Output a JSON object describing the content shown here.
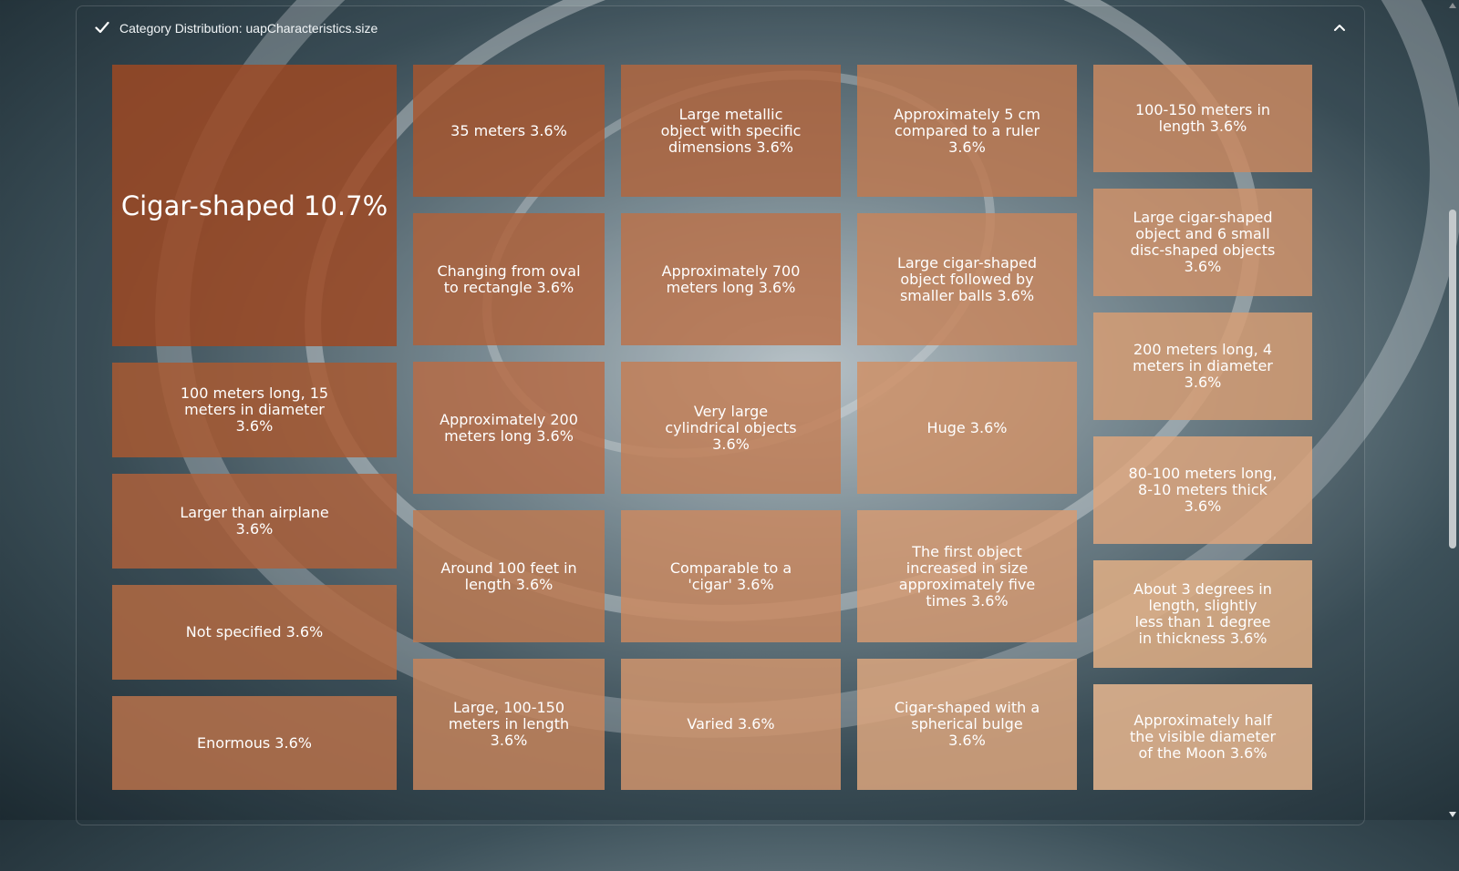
{
  "header": {
    "title": "Category Distribution: uapCharacteristics.size"
  },
  "icons": {
    "check": "check-icon",
    "collapse": "chevron-up-icon"
  },
  "colors": {
    "tile_dark": "#8f330d",
    "tile_light": "#f4c79d"
  },
  "chart_data": {
    "type": "treemap",
    "items": [
      {
        "label": "Cigar-shaped",
        "percent": 10.7
      },
      {
        "label": "100 meters long, 15 meters in diameter",
        "percent": 3.6
      },
      {
        "label": "Larger than airplane",
        "percent": 3.6
      },
      {
        "label": "Not specified",
        "percent": 3.6
      },
      {
        "label": "Enormous",
        "percent": 3.6
      },
      {
        "label": "35 meters",
        "percent": 3.6
      },
      {
        "label": "Changing from oval to rectangle",
        "percent": 3.6
      },
      {
        "label": "Approximately 200 meters long",
        "percent": 3.6
      },
      {
        "label": "Around 100 feet in length",
        "percent": 3.6
      },
      {
        "label": "Large, 100-150 meters in length",
        "percent": 3.6
      },
      {
        "label": "Large metallic object with specific dimensions",
        "percent": 3.6
      },
      {
        "label": "Approximately 700 meters long",
        "percent": 3.6
      },
      {
        "label": "Very large cylindrical objects",
        "percent": 3.6
      },
      {
        "label": "Comparable to a 'cigar'",
        "percent": 3.6
      },
      {
        "label": "Varied",
        "percent": 3.6
      },
      {
        "label": "Approximately 5 cm compared to a ruler",
        "percent": 3.6
      },
      {
        "label": "Large cigar-shaped object followed by smaller balls",
        "percent": 3.6
      },
      {
        "label": "Huge",
        "percent": 3.6
      },
      {
        "label": "The first object increased in size approximately five times",
        "percent": 3.6
      },
      {
        "label": "Cigar-shaped with a spherical bulge",
        "percent": 3.6
      },
      {
        "label": "100-150 meters in length",
        "percent": 3.6
      },
      {
        "label": "Large cigar-shaped object and 6 small disc-shaped objects",
        "percent": 3.6
      },
      {
        "label": "200 meters long, 4 meters in diameter",
        "percent": 3.6
      },
      {
        "label": "80-100 meters long, 8-10 meters thick",
        "percent": 3.6
      },
      {
        "label": "About 3 degrees in length, slightly less than 1 degree in thickness",
        "percent": 3.6
      },
      {
        "label": "Approximately half the visible diameter of the Moon",
        "percent": 3.6
      }
    ],
    "tile_text": [
      "Cigar-shaped  10.7%",
      "100 meters long, 15\nmeters in diameter\n3.6%",
      "Larger than airplane\n3.6%",
      "Not specified  3.6%",
      "Enormous  3.6%",
      "35 meters  3.6%",
      "Changing from oval\nto rectangle  3.6%",
      "Approximately 200\nmeters long  3.6%",
      "Around 100 feet in\nlength  3.6%",
      "Large, 100-150\nmeters in length\n3.6%",
      "Large metallic\nobject with specific\ndimensions  3.6%",
      "Approximately 700\nmeters long  3.6%",
      "Very large\ncylindrical objects\n3.6%",
      "Comparable to a\n'cigar'  3.6%",
      "Varied  3.6%",
      "Approximately 5 cm\ncompared to a ruler\n3.6%",
      "Large cigar-shaped\nobject followed by\nsmaller balls  3.6%",
      "Huge  3.6%",
      "The first object\nincreased in size\napproximately five\ntimes  3.6%",
      "Cigar-shaped with a\nspherical bulge\n3.6%",
      "100-150 meters in\nlength  3.6%",
      "Large cigar-shaped\nobject and 6 small\ndisc-shaped objects\n3.6%",
      "200 meters long, 4\nmeters in diameter\n3.6%",
      "80-100 meters long,\n8-10 meters thick\n3.6%",
      "About 3 degrees in\nlength, slightly\nless than 1 degree\nin thickness  3.6%",
      "Approximately half\nthe visible diameter\nof the Moon  3.6%"
    ]
  }
}
